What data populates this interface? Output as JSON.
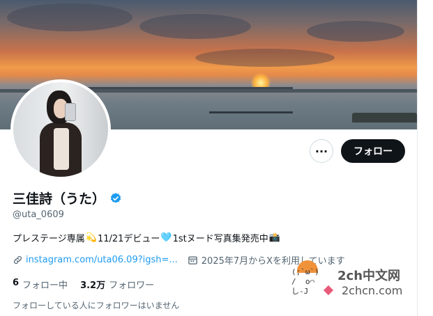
{
  "profile": {
    "display_name": "三佳詩（うた）",
    "handle": "@uta_0609",
    "bio": {
      "part1": "プレステージ専属",
      "emoji1": "💫",
      "part2": "11/21デビュー",
      "emoji2": "🩵",
      "part3": "1stヌード写真集発売中",
      "emoji3": "📸"
    },
    "link": "instagram.com/uta06.09?igsh=...",
    "joined": "2025年7月からXを利用しています",
    "following_count": "6",
    "following_label": "フォロー中",
    "followers_count": "3.2万",
    "followers_label": "フォロワー",
    "followers_note": "フォローしている人にフォロワーはいません"
  },
  "actions": {
    "more_label": "···",
    "follow_label": "フォロー"
  },
  "watermark": {
    "face": "(;`ω`)\n/  o⌒\nし-J",
    "title": "2ch中文网",
    "url": "2chcn.com"
  },
  "icons": {
    "verified": "verified-badge-icon",
    "link": "link-icon",
    "calendar": "calendar-icon",
    "more": "more-icon"
  },
  "colors": {
    "accent": "#1d9bf0",
    "text_primary": "#0f1419",
    "text_secondary": "#536471",
    "button_dark": "#0f1419"
  }
}
